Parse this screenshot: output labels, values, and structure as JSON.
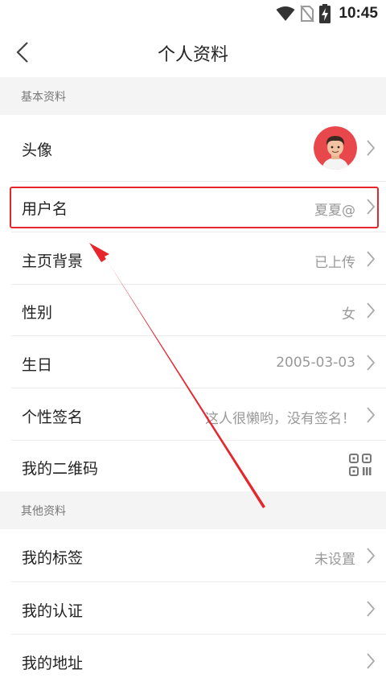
{
  "status_bar": {
    "time": "10:45",
    "icons": [
      "wifi-icon",
      "no-sim-icon",
      "battery-charging-icon"
    ]
  },
  "header": {
    "title": "个人资料",
    "back_icon": "chevron-left-icon"
  },
  "sections": {
    "basic": {
      "title": "基本资料",
      "rows": {
        "avatar": {
          "label": "头像"
        },
        "username": {
          "label": "用户名",
          "value": "夏夏@"
        },
        "background": {
          "label": "主页背景",
          "value": "已上传"
        },
        "gender": {
          "label": "性别",
          "value": "女"
        },
        "birthday": {
          "label": "生日",
          "value": "2005-03-03"
        },
        "signature": {
          "label": "个性签名",
          "value": "这人很懒哟，没有签名！"
        },
        "qrcode": {
          "label": "我的二维码",
          "icon": "qr-code-icon"
        }
      }
    },
    "other": {
      "title": "其他资料",
      "rows": {
        "tags": {
          "label": "我的标签",
          "value": "未设置"
        },
        "verification": {
          "label": "我的认证"
        },
        "address": {
          "label": "我的地址"
        }
      }
    }
  },
  "colors": {
    "background": "#ffffff",
    "section_bg": "#f4f4f4",
    "highlight_red": "#e6262c",
    "value_gray": "#999999",
    "avatar_bg": "#e8474b"
  }
}
